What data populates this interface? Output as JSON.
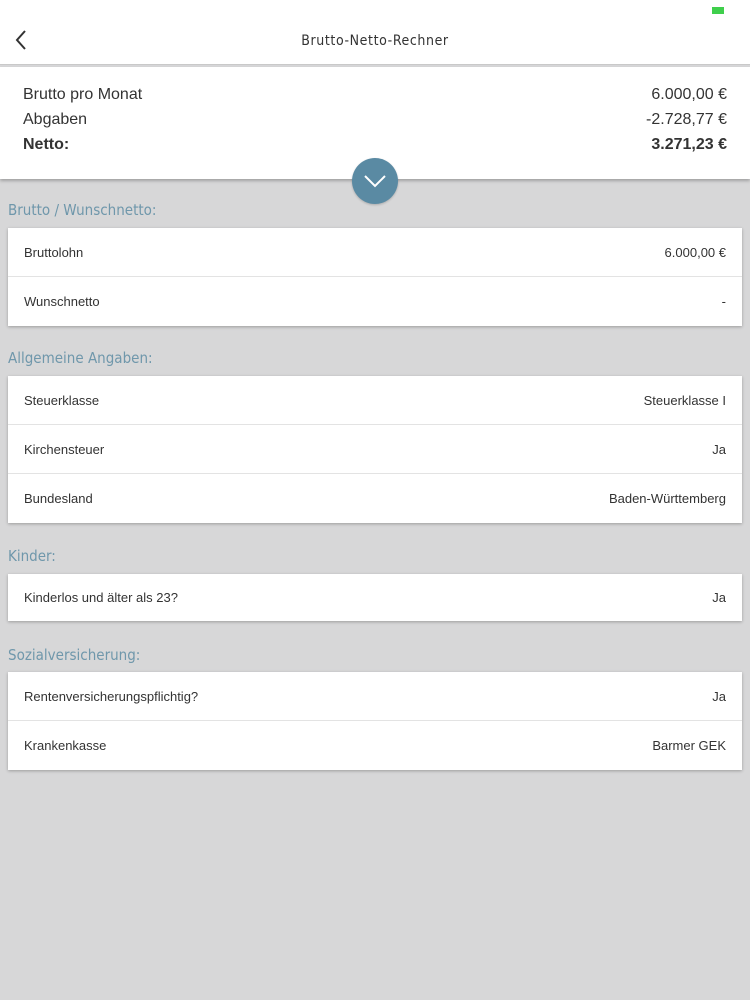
{
  "nav": {
    "title": "Brutto-Netto-Rechner"
  },
  "summary": {
    "rows": [
      {
        "label": "Brutto pro Monat",
        "value": "6.000,00 €"
      },
      {
        "label": "Abgaben",
        "value": "-2.728,77 €"
      },
      {
        "label": "Netto:",
        "value": "3.271,23 €"
      }
    ]
  },
  "sections": [
    {
      "title": "Brutto / Wunschnetto:",
      "rows": [
        {
          "label": "Bruttolohn",
          "value": "6.000,00 €"
        },
        {
          "label": "Wunschnetto",
          "value": "-"
        }
      ]
    },
    {
      "title": "Allgemeine Angaben:",
      "rows": [
        {
          "label": "Steuerklasse",
          "value": "Steuerklasse I"
        },
        {
          "label": "Kirchensteuer",
          "value": "Ja"
        },
        {
          "label": "Bundesland",
          "value": "Baden-Württemberg"
        }
      ]
    },
    {
      "title": "Kinder:",
      "rows": [
        {
          "label": "Kinderlos und älter als 23?",
          "value": "Ja"
        }
      ]
    },
    {
      "title": "Sozialversicherung:",
      "rows": [
        {
          "label": "Rentenversicherungspflichtig?",
          "value": "Ja"
        },
        {
          "label": "Krankenkasse",
          "value": "Barmer GEK"
        }
      ]
    }
  ],
  "icons": {
    "back": "chevron-left-icon",
    "expand": "chevron-down-icon",
    "battery": "battery-icon"
  },
  "colors": {
    "accent": "#5a8aa3",
    "section_header": "#6f97ab",
    "background": "#d7d7d8",
    "battery": "#3fcf4c"
  }
}
